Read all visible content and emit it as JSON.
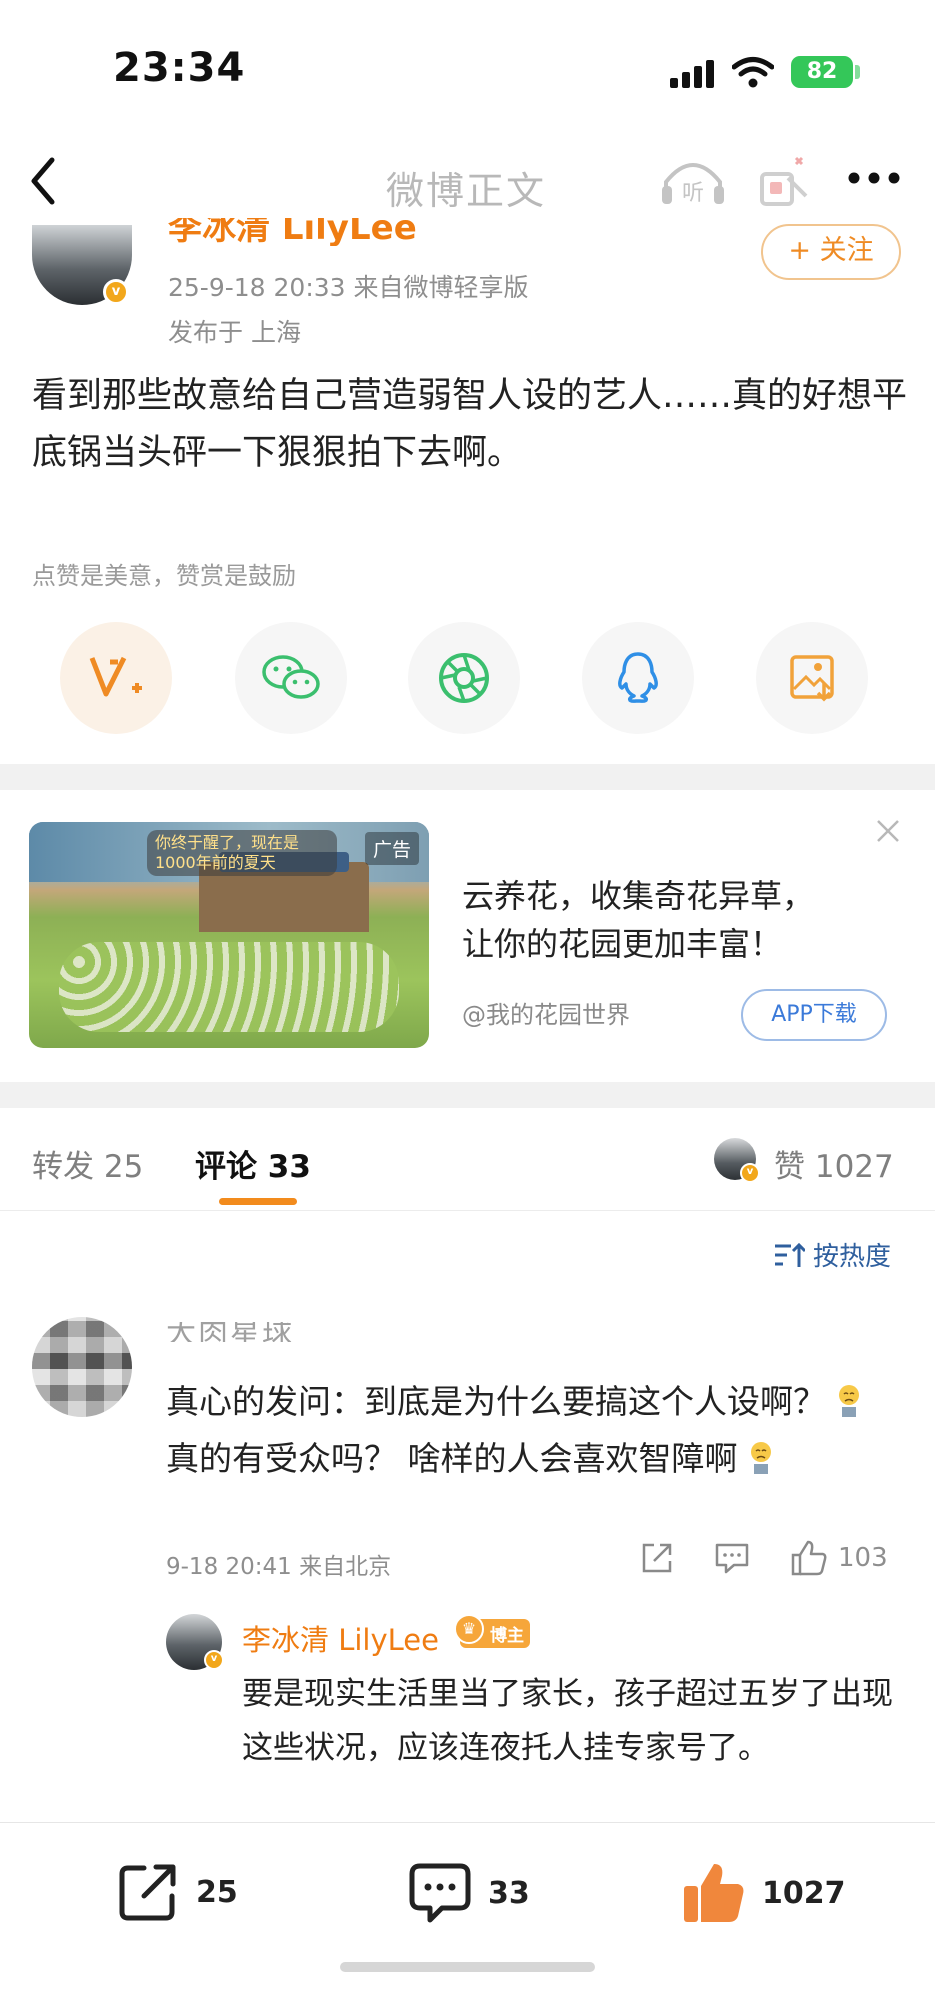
{
  "status_bar": {
    "time": "23:34",
    "battery": "82"
  },
  "nav": {
    "title": "微博正文"
  },
  "post": {
    "author": "李冰清 LilyLee",
    "datetime_source": "25-9-18 20:33  来自微博轻享版",
    "location": "发布于 上海",
    "follow_label": "+ 关注",
    "content": "看到那些故意给自己营造弱智人设的艺人……真的好想平底锅当头砰一下狠狠拍下去啊。",
    "like_hint": "点赞是美意，赞赏是鼓励"
  },
  "ad": {
    "tag": "广告",
    "bubble": "你终于醒了，现在是1000年前的夏天",
    "line1": "云养花，收集奇花异草，",
    "line2": "让你的花园更加丰富！",
    "source": "@我的花园世界",
    "button": "APP下载"
  },
  "tabs": {
    "repost": "转发 25",
    "comment": "评论 33",
    "like": "赞 1027"
  },
  "sort": {
    "label": "按热度"
  },
  "comment": {
    "name": "大肉星球",
    "text_a": "真心的发问：到底是为什么要搞这个人设啊？",
    "text_b": "真的有受众吗？  啥样的人会喜欢智障啊",
    "meta": "9-18 20:41  来自北京",
    "likes": "103"
  },
  "reply": {
    "name": "李冰清 LilyLee",
    "badge": "博主",
    "text": "要是现实生活里当了家长，孩子超过五岁了出现这些状况，应该连夜托人挂专家号了。"
  },
  "bottom_bar": {
    "repost": "25",
    "comment": "33",
    "like": "1027"
  },
  "colors": {
    "accent": "#f28b1d",
    "link": "#2f5f9e",
    "battery": "#34c759"
  }
}
